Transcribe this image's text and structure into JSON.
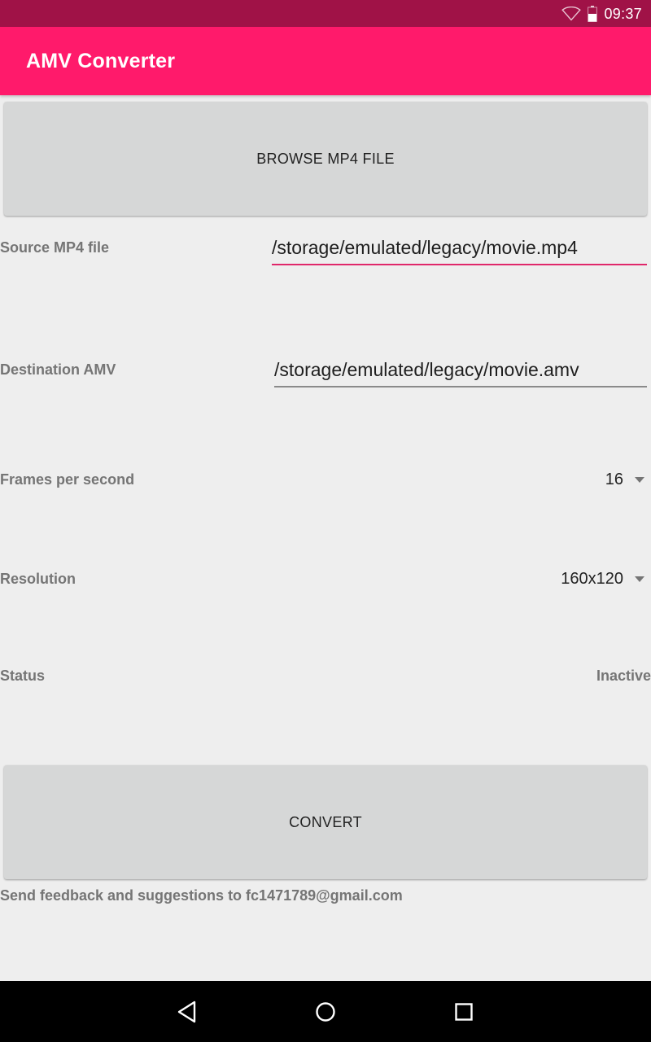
{
  "status_bar": {
    "time": "09:37",
    "icons": [
      "wifi-icon",
      "battery-icon"
    ]
  },
  "app_bar": {
    "title": "AMV Converter"
  },
  "form": {
    "browse_button": "BROWSE MP4 FILE",
    "source_label": "Source MP4 file",
    "source_value": "/storage/emulated/legacy/movie.mp4",
    "destination_label": "Destination AMV",
    "destination_value": "/storage/emulated/legacy/movie.amv",
    "fps_label": "Frames per second",
    "fps_value": "16",
    "resolution_label": "Resolution",
    "resolution_value": "160x120",
    "status_label": "Status",
    "status_value": "Inactive",
    "convert_button": "CONVERT",
    "feedback": "Send feedback and suggestions to fc1471789@gmail.com"
  },
  "nav_bar": {
    "icons": [
      "back-icon",
      "home-icon",
      "recents-icon"
    ]
  },
  "colors": {
    "status_bar": "#a01247",
    "app_bar": "#ff1a6b",
    "accent": "#e0276a",
    "background": "#eeeeee",
    "button": "#d6d7d7"
  }
}
